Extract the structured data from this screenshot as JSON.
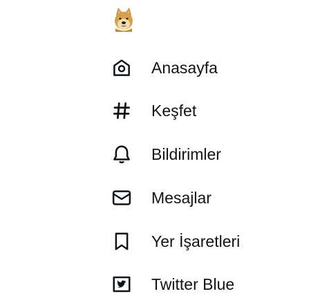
{
  "sidebar": {
    "logo": {
      "icon": "doge-logo-icon"
    },
    "items": [
      {
        "label": "Anasayfa",
        "icon": "home-icon"
      },
      {
        "label": "Keşfet",
        "icon": "hashtag-icon"
      },
      {
        "label": "Bildirimler",
        "icon": "bell-icon"
      },
      {
        "label": "Mesajlar",
        "icon": "envelope-icon"
      },
      {
        "label": "Yer İşaretleri",
        "icon": "bookmark-icon"
      },
      {
        "label": "Twitter Blue",
        "icon": "twitter-blue-icon"
      }
    ]
  }
}
